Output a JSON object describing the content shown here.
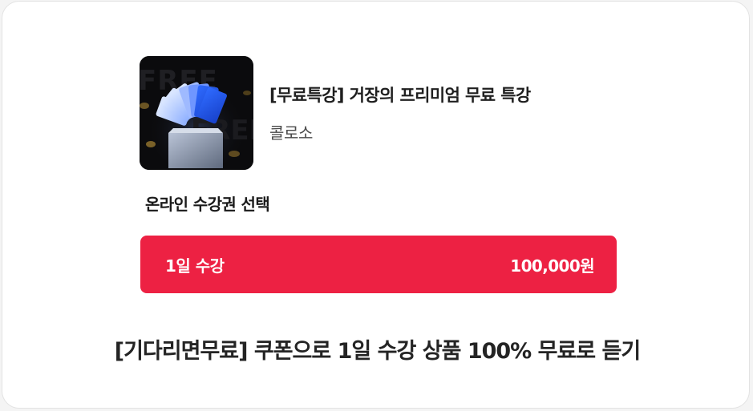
{
  "course": {
    "title": "[무료특강] 거장의 프리미엄 무료 특강",
    "instructor": "콜로소",
    "thumbnail_text": "FREE",
    "thumbnail_icon": "blue-card-fan-on-pedestal"
  },
  "purchase": {
    "section_label": "온라인 수강권 선택",
    "options": [
      {
        "name": "1일 수강",
        "price": "100,000원",
        "selected": true
      }
    ]
  },
  "promo": {
    "text": "[기다리면무료] 쿠폰으로 1일 수강 상품 100% 무료로 듣기"
  },
  "colors": {
    "accent": "#ED2143",
    "card_background": "#FFFFFF",
    "page_background": "#F4F4F4",
    "title_text": "#1F1F1F"
  }
}
